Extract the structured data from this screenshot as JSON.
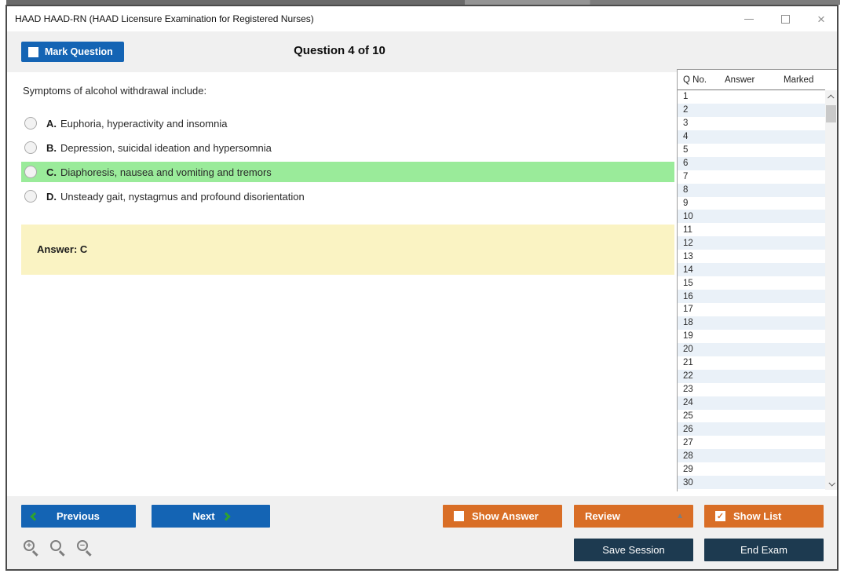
{
  "window": {
    "title": "HAAD HAAD-RN (HAAD Licensure Examination for Registered Nurses)",
    "controls": {
      "minimize": "minimize",
      "maximize": "maximize",
      "close": "×"
    }
  },
  "header": {
    "mark_question_label": "Mark Question",
    "question_counter": "Question 4 of 10"
  },
  "question": {
    "text": "Symptoms of alcohol withdrawal include:",
    "options": [
      {
        "letter": "A.",
        "text": "Euphoria, hyperactivity and insomnia",
        "highlighted": false
      },
      {
        "letter": "B.",
        "text": "Depression, suicidal ideation and hypersomnia",
        "highlighted": false
      },
      {
        "letter": "C.",
        "text": "Diaphoresis, nausea and vomiting and tremors",
        "highlighted": true
      },
      {
        "letter": "D.",
        "text": "Unsteady gait, nystagmus and profound disorientation",
        "highlighted": false
      }
    ],
    "answer_label": "Answer: C"
  },
  "question_list": {
    "headers": {
      "qno": "Q No.",
      "answer": "Answer",
      "marked": "Marked"
    },
    "visible_rows": [
      "1",
      "2",
      "3",
      "4",
      "5",
      "6",
      "7",
      "8",
      "9",
      "10",
      "11",
      "12",
      "13",
      "14",
      "15",
      "16",
      "17",
      "18",
      "19",
      "20",
      "21",
      "22",
      "23",
      "24",
      "25",
      "26",
      "27",
      "28",
      "29",
      "30"
    ]
  },
  "footer": {
    "previous_label": "Previous",
    "next_label": "Next",
    "show_answer_label": "Show Answer",
    "review_label": "Review",
    "review_arrow": "▲",
    "show_list_label": "Show List",
    "show_list_checked": "✓",
    "save_session_label": "Save Session",
    "end_exam_label": "End Exam"
  },
  "icons": {
    "zoom_in": "zoom-in-icon",
    "zoom_default": "zoom-icon",
    "zoom_out": "zoom-out-icon"
  },
  "colors": {
    "accent_blue": "#1464b4",
    "accent_orange": "#d96e26",
    "accent_navy": "#1d3a50",
    "highlight_green": "#9aeb9a",
    "answer_yellow": "#faf3c3",
    "row_alt_blue": "#eaf1f8",
    "chrome_gray": "#f0f0f0"
  }
}
